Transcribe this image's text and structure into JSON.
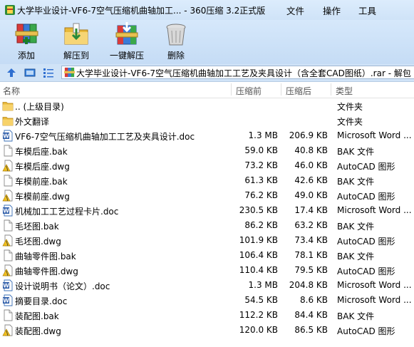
{
  "window": {
    "title": "大学毕业设计-VF6-7空气压缩机曲轴加工... - 360压缩 3.2正式版",
    "menu": [
      "文件",
      "操作",
      "工具"
    ]
  },
  "toolbar": {
    "buttons": [
      {
        "label": "添加",
        "icon": "add-books-icon"
      },
      {
        "label": "解压到",
        "icon": "extract-folder-icon"
      },
      {
        "label": "一键解压",
        "icon": "one-click-extract-icon"
      },
      {
        "label": "删除",
        "icon": "trash-icon"
      }
    ]
  },
  "address": {
    "path": "大学毕业设计-VF6-7空气压缩机曲轴加工工艺及夹具设计（含全套CAD图纸）.rar - 解包"
  },
  "columns": {
    "name": "名称",
    "compressed": "压缩前",
    "original": "压缩后",
    "type": "类型"
  },
  "files": [
    {
      "name": ".. (上级目录)",
      "compressed": "",
      "original": "",
      "type": "文件夹",
      "icon": "folder-icon"
    },
    {
      "name": "外文翻译",
      "compressed": "",
      "original": "",
      "type": "文件夹",
      "icon": "folder-icon"
    },
    {
      "name": "VF6-7空气压缩机曲轴加工工艺及夹具设计.doc",
      "compressed": "1.3 MB",
      "original": "206.9 KB",
      "type": "Microsoft Word ...",
      "icon": "word-doc-icon"
    },
    {
      "name": "车模后座.bak",
      "compressed": "59.0 KB",
      "original": "40.8 KB",
      "type": "BAK 文件",
      "icon": "blank-file-icon"
    },
    {
      "name": "车模后座.dwg",
      "compressed": "73.2 KB",
      "original": "46.0 KB",
      "type": "AutoCAD 图形",
      "icon": "dwg-file-icon"
    },
    {
      "name": "车模前座.bak",
      "compressed": "61.3 KB",
      "original": "42.6 KB",
      "type": "BAK 文件",
      "icon": "blank-file-icon"
    },
    {
      "name": "车模前座.dwg",
      "compressed": "76.2 KB",
      "original": "49.0 KB",
      "type": "AutoCAD 图形",
      "icon": "dwg-file-icon"
    },
    {
      "name": "机械加工工艺过程卡片.doc",
      "compressed": "230.5 KB",
      "original": "17.4 KB",
      "type": "Microsoft Word ...",
      "icon": "word-doc-icon"
    },
    {
      "name": "毛坯图.bak",
      "compressed": "86.2 KB",
      "original": "63.2 KB",
      "type": "BAK 文件",
      "icon": "blank-file-icon"
    },
    {
      "name": "毛坯图.dwg",
      "compressed": "101.9 KB",
      "original": "73.4 KB",
      "type": "AutoCAD 图形",
      "icon": "dwg-file-icon"
    },
    {
      "name": "曲轴零件图.bak",
      "compressed": "106.4 KB",
      "original": "78.1 KB",
      "type": "BAK 文件",
      "icon": "blank-file-icon"
    },
    {
      "name": "曲轴零件图.dwg",
      "compressed": "110.4 KB",
      "original": "79.5 KB",
      "type": "AutoCAD 图形",
      "icon": "dwg-file-icon"
    },
    {
      "name": "设计说明书（论文）.doc",
      "compressed": "1.3 MB",
      "original": "204.8 KB",
      "type": "Microsoft Word ...",
      "icon": "word-doc-icon"
    },
    {
      "name": "摘要目录.doc",
      "compressed": "54.5 KB",
      "original": "8.6 KB",
      "type": "Microsoft Word ...",
      "icon": "word-doc-icon"
    },
    {
      "name": "装配图.bak",
      "compressed": "112.2 KB",
      "original": "84.4 KB",
      "type": "BAK 文件",
      "icon": "blank-file-icon"
    },
    {
      "name": "装配图.dwg",
      "compressed": "120.0 KB",
      "original": "86.5 KB",
      "type": "AutoCAD 图形",
      "icon": "dwg-file-icon"
    }
  ]
}
